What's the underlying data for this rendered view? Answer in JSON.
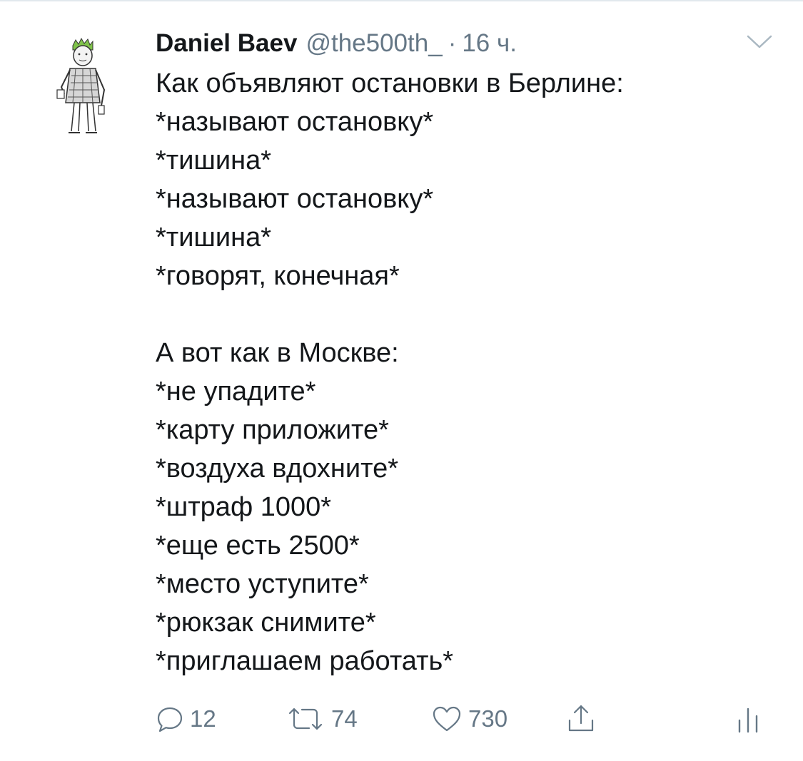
{
  "tweet": {
    "author_name": "Daniel Baev",
    "author_handle": "@the500th_",
    "separator": "·",
    "time": "16 ч.",
    "lines": [
      "Как объявляют остановки в Берлине:",
      "*называют остановку*",
      "*тишина*",
      "*называют остановку*",
      "*тишина*",
      "*говорят, конечная*",
      "",
      "А вот как в Москве:",
      "*не упадите*",
      "*карту приложите*",
      "*воздуха вдохните*",
      "*штраф 1000*",
      "*еще есть 2500*",
      "*место уступите*",
      "*рюкзак снимите*",
      "*приглашаем работать*"
    ]
  },
  "actions": {
    "reply_count": "12",
    "retweet_count": "74",
    "like_count": "730"
  },
  "icons": {
    "reply": "reply-icon",
    "retweet": "retweet-icon",
    "like": "heart-icon",
    "share": "share-icon",
    "analytics": "analytics-icon",
    "menu": "chevron-down-icon"
  },
  "colors": {
    "text": "#14171a",
    "secondary": "#657786",
    "divider": "#e1e8ed",
    "avatar_hair": "#7fc24a"
  }
}
